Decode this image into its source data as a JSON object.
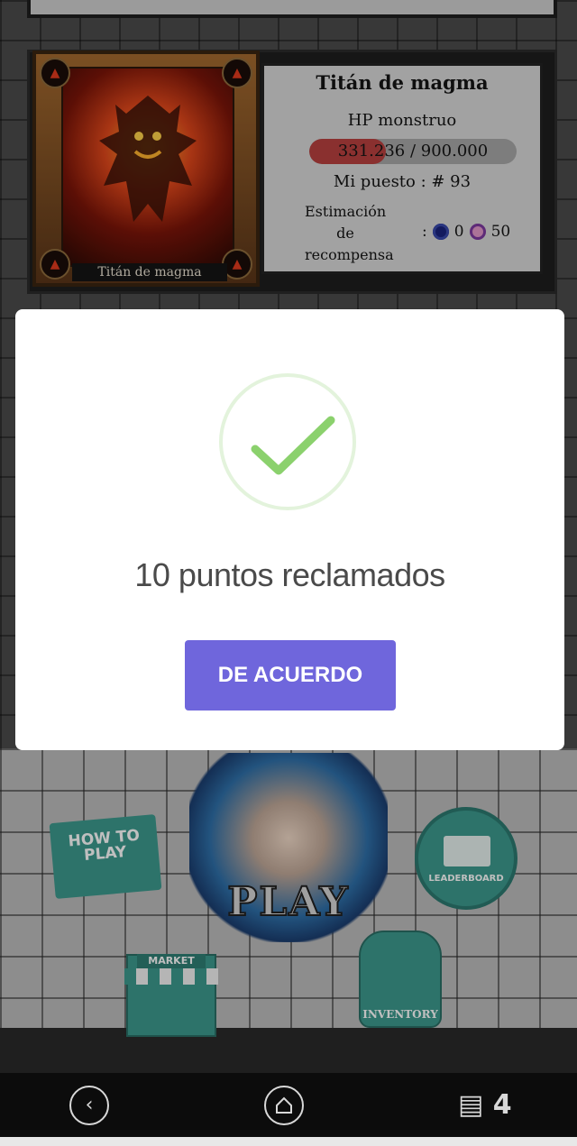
{
  "boss": {
    "card_name": "Titán de magma",
    "title": "Titán de magma",
    "hp_label": "HP monstruo",
    "hp_current": "331.236",
    "hp_max": "900.000",
    "hp_text": "331.236 / 900.000",
    "hp_fraction": 0.368,
    "rank_text": "Mi puesto : # 93",
    "reward_label_line1": "Estimación",
    "reward_label_line2": "de",
    "reward_label_line3": "recompensa",
    "reward_separator": ":",
    "reward_steem": "0",
    "reward_points": "50"
  },
  "menu": {
    "how_to_play": "HOW TO PLAY",
    "play": "PLAY",
    "leaderboard": "LEADERBOARD",
    "market": "MARKET",
    "inventory": "INVENTORY"
  },
  "modal": {
    "icon": "check-icon",
    "message": "10 puntos reclamados",
    "confirm_label": "DE ACUERDO"
  },
  "navbar": {
    "back_icon": "back-icon",
    "home_icon": "home-icon",
    "recent_label": "▤ 4"
  },
  "colors": {
    "accent_button": "#6f66dc",
    "check_green": "#8bd16d",
    "hp_fill": "#b8413f",
    "menu_teal": "#3c9a8e"
  }
}
